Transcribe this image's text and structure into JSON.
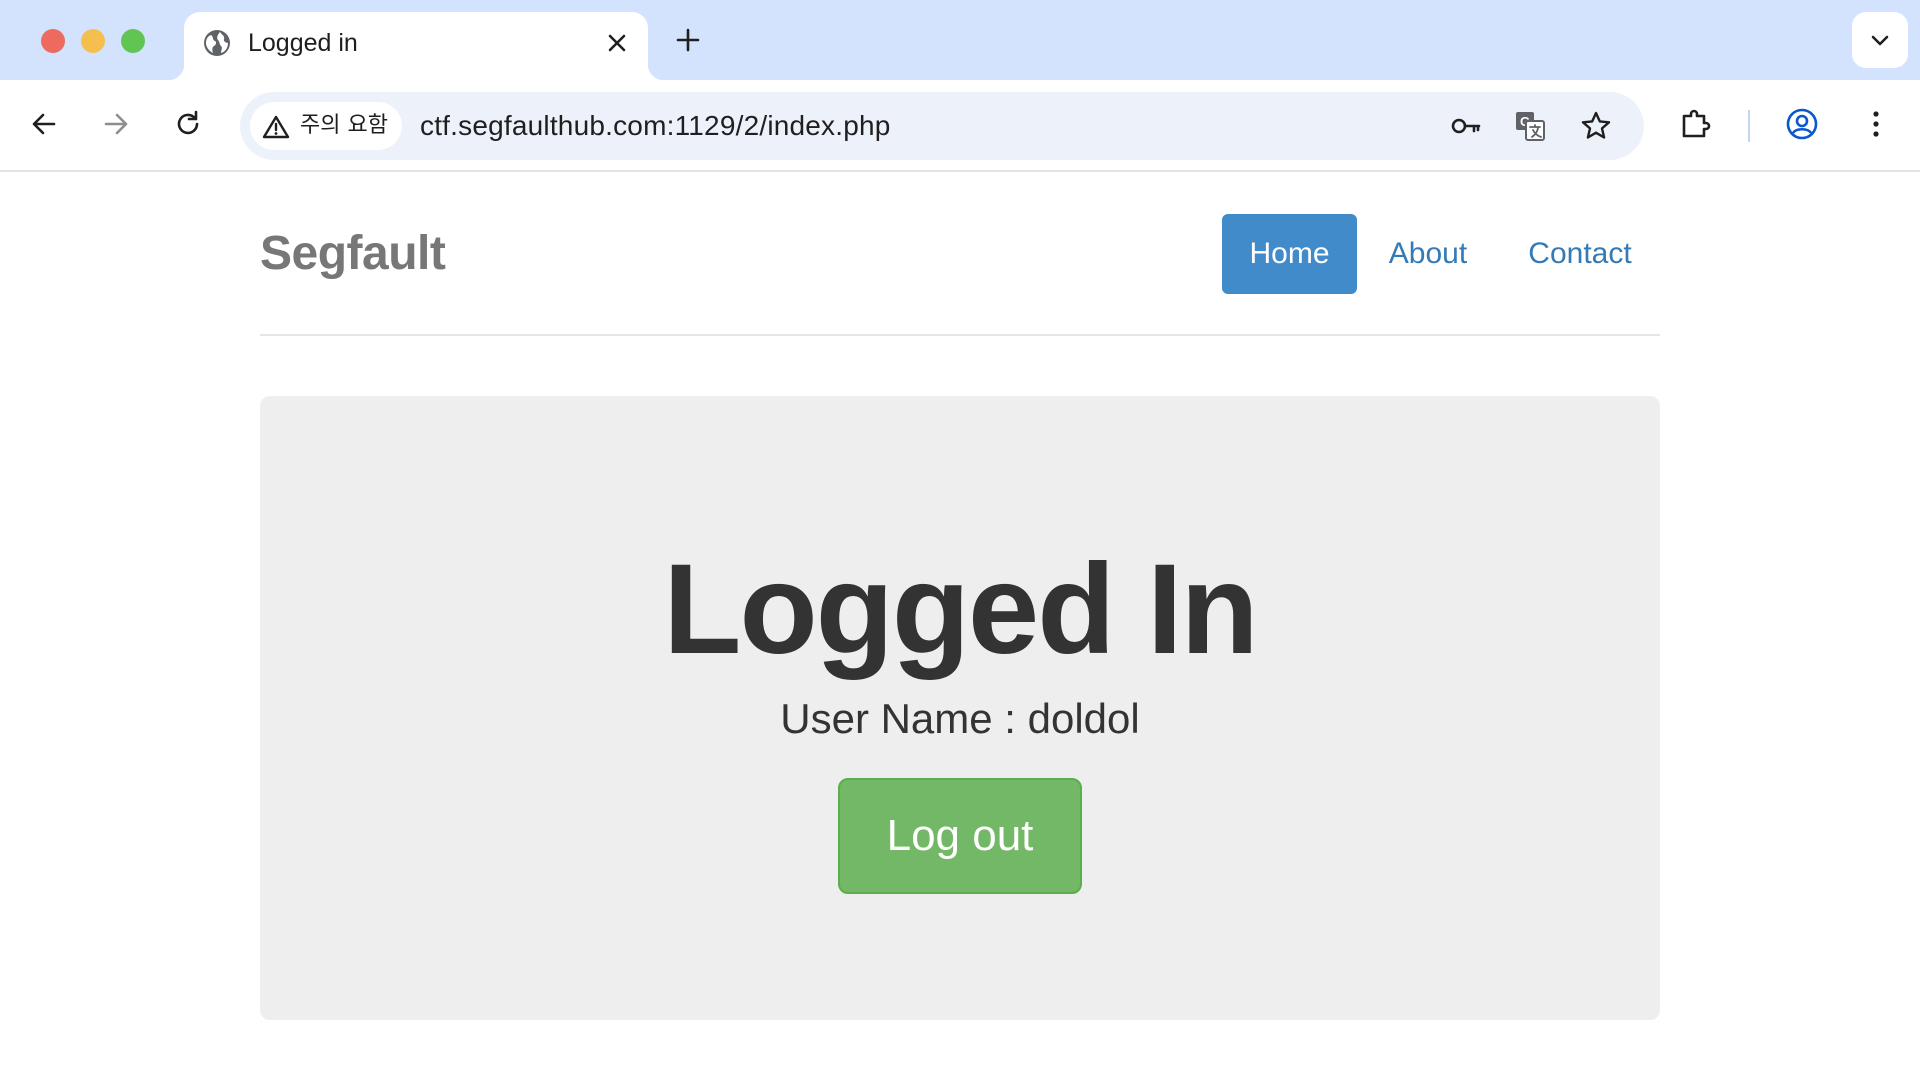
{
  "browser": {
    "tab": {
      "title": "Logged in"
    },
    "omnibox": {
      "security_chip": "주의 요함",
      "url": "ctf.segfaulthub.com:1129/2/index.php"
    }
  },
  "site": {
    "brand": "Segfault",
    "nav": [
      {
        "label": "Home",
        "active": true
      },
      {
        "label": "About",
        "active": false
      },
      {
        "label": "Contact",
        "active": false
      }
    ]
  },
  "main": {
    "heading": "Logged In",
    "username_line": "User Name : doldol",
    "logout_label": "Log out"
  },
  "colors": {
    "tabstrip": "#d3e3fd",
    "nav_active": "#428bca",
    "link": "#337ab7",
    "logout": "#73b866",
    "jumbotron": "#eeeeee"
  }
}
